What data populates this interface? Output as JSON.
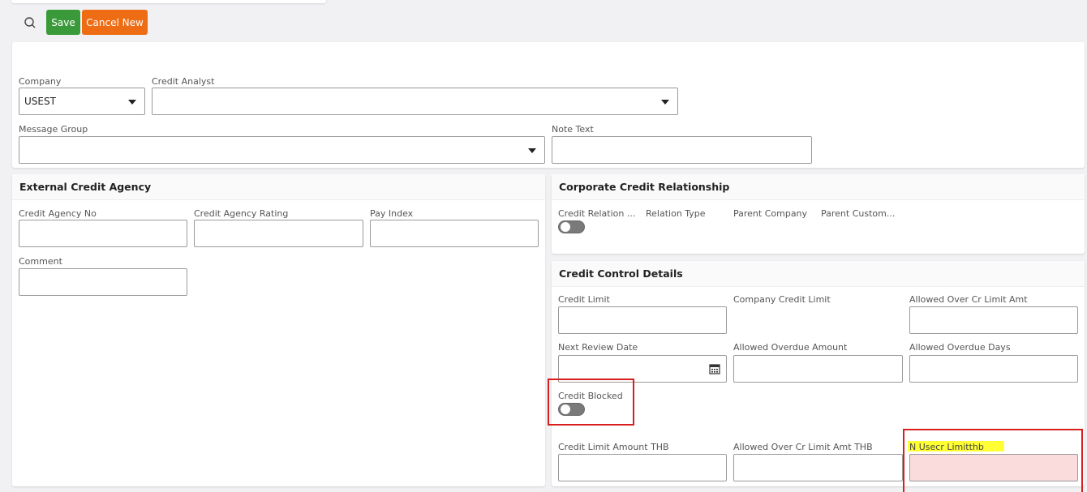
{
  "toolbar": {
    "search_icon": "search-icon",
    "save_label": "Save",
    "cancel_label": "Cancel New",
    "save_color": "#3a9a3a",
    "cancel_color": "#ee6c13"
  },
  "general": {
    "company_label": "Company",
    "company_value": "USEST",
    "credit_analyst_label": "Credit Analyst",
    "credit_analyst_value": "",
    "message_group_label": "Message Group",
    "message_group_value": "",
    "note_text_label": "Note Text",
    "note_text_value": ""
  },
  "external_agency": {
    "title": "External Credit Agency",
    "credit_agency_no_label": "Credit Agency No",
    "credit_agency_rating_label": "Credit Agency Rating",
    "pay_index_label": "Pay Index",
    "comment_label": "Comment"
  },
  "corporate_relationship": {
    "title": "Corporate Credit Relationship",
    "credit_relation_label": "Credit Relation ...",
    "relation_type_label": "Relation Type",
    "parent_company_label": "Parent Company",
    "parent_customer_label": "Parent Custom..."
  },
  "credit_control": {
    "title": "Credit Control Details",
    "credit_limit_label": "Credit Limit",
    "company_credit_limit_label": "Company Credit Limit",
    "allowed_over_cr_limit_amt_label": "Allowed Over Cr Limit Amt",
    "next_review_date_label": "Next Review Date",
    "allowed_overdue_amount_label": "Allowed Overdue Amount",
    "allowed_overdue_days_label": "Allowed Overdue Days",
    "credit_blocked_label": "Credit Blocked",
    "credit_limit_amount_thb_label": "Credit Limit Amount THB",
    "allowed_over_cr_limit_amt_thb_label": "Allowed Over Cr Limit Amt THB",
    "n_usecr_limit_thb_label": "N Usecr Limitthb"
  },
  "colors": {
    "annotation_red": "#d81e1e",
    "highlight_yellow": "#ffff33",
    "required_field_bg": "#fadcdc"
  }
}
